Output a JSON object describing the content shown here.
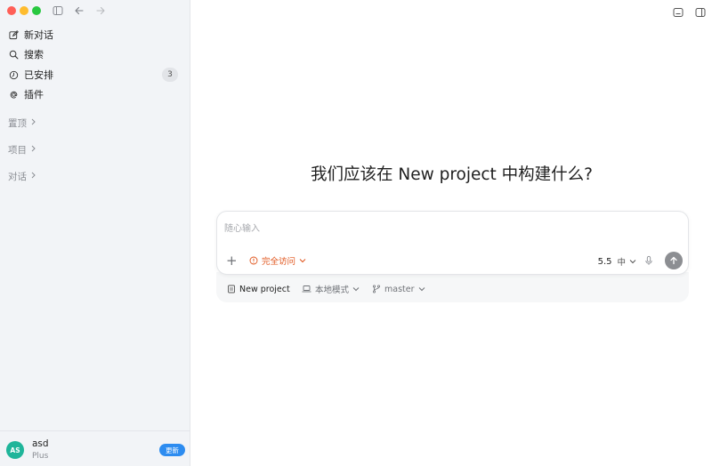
{
  "sidebar": {
    "nav": [
      {
        "label": "新对话",
        "icon": "new-chat-icon"
      },
      {
        "label": "搜索",
        "icon": "search-icon"
      },
      {
        "label": "已安排",
        "icon": "clock-icon",
        "badge": "3"
      },
      {
        "label": "插件",
        "icon": "at-icon"
      }
    ],
    "sections": [
      "置顶",
      "项目",
      "对话"
    ]
  },
  "user": {
    "initials": "AS",
    "name": "asd",
    "plan": "Plus",
    "update_label": "更新"
  },
  "main": {
    "headline": "我们应该在 New project 中构建什么?",
    "composer": {
      "placeholder": "随心输入",
      "access_label": "完全访问",
      "model_version": "5.5",
      "model_level": "中"
    },
    "context": {
      "project": "New project",
      "mode": "本地模式",
      "branch": "master"
    }
  },
  "colors": {
    "accent": "#2d8cf0",
    "warning": "#e0541b",
    "avatar": "#1fb59a",
    "sidebar_bg": "#f2f4f7"
  }
}
